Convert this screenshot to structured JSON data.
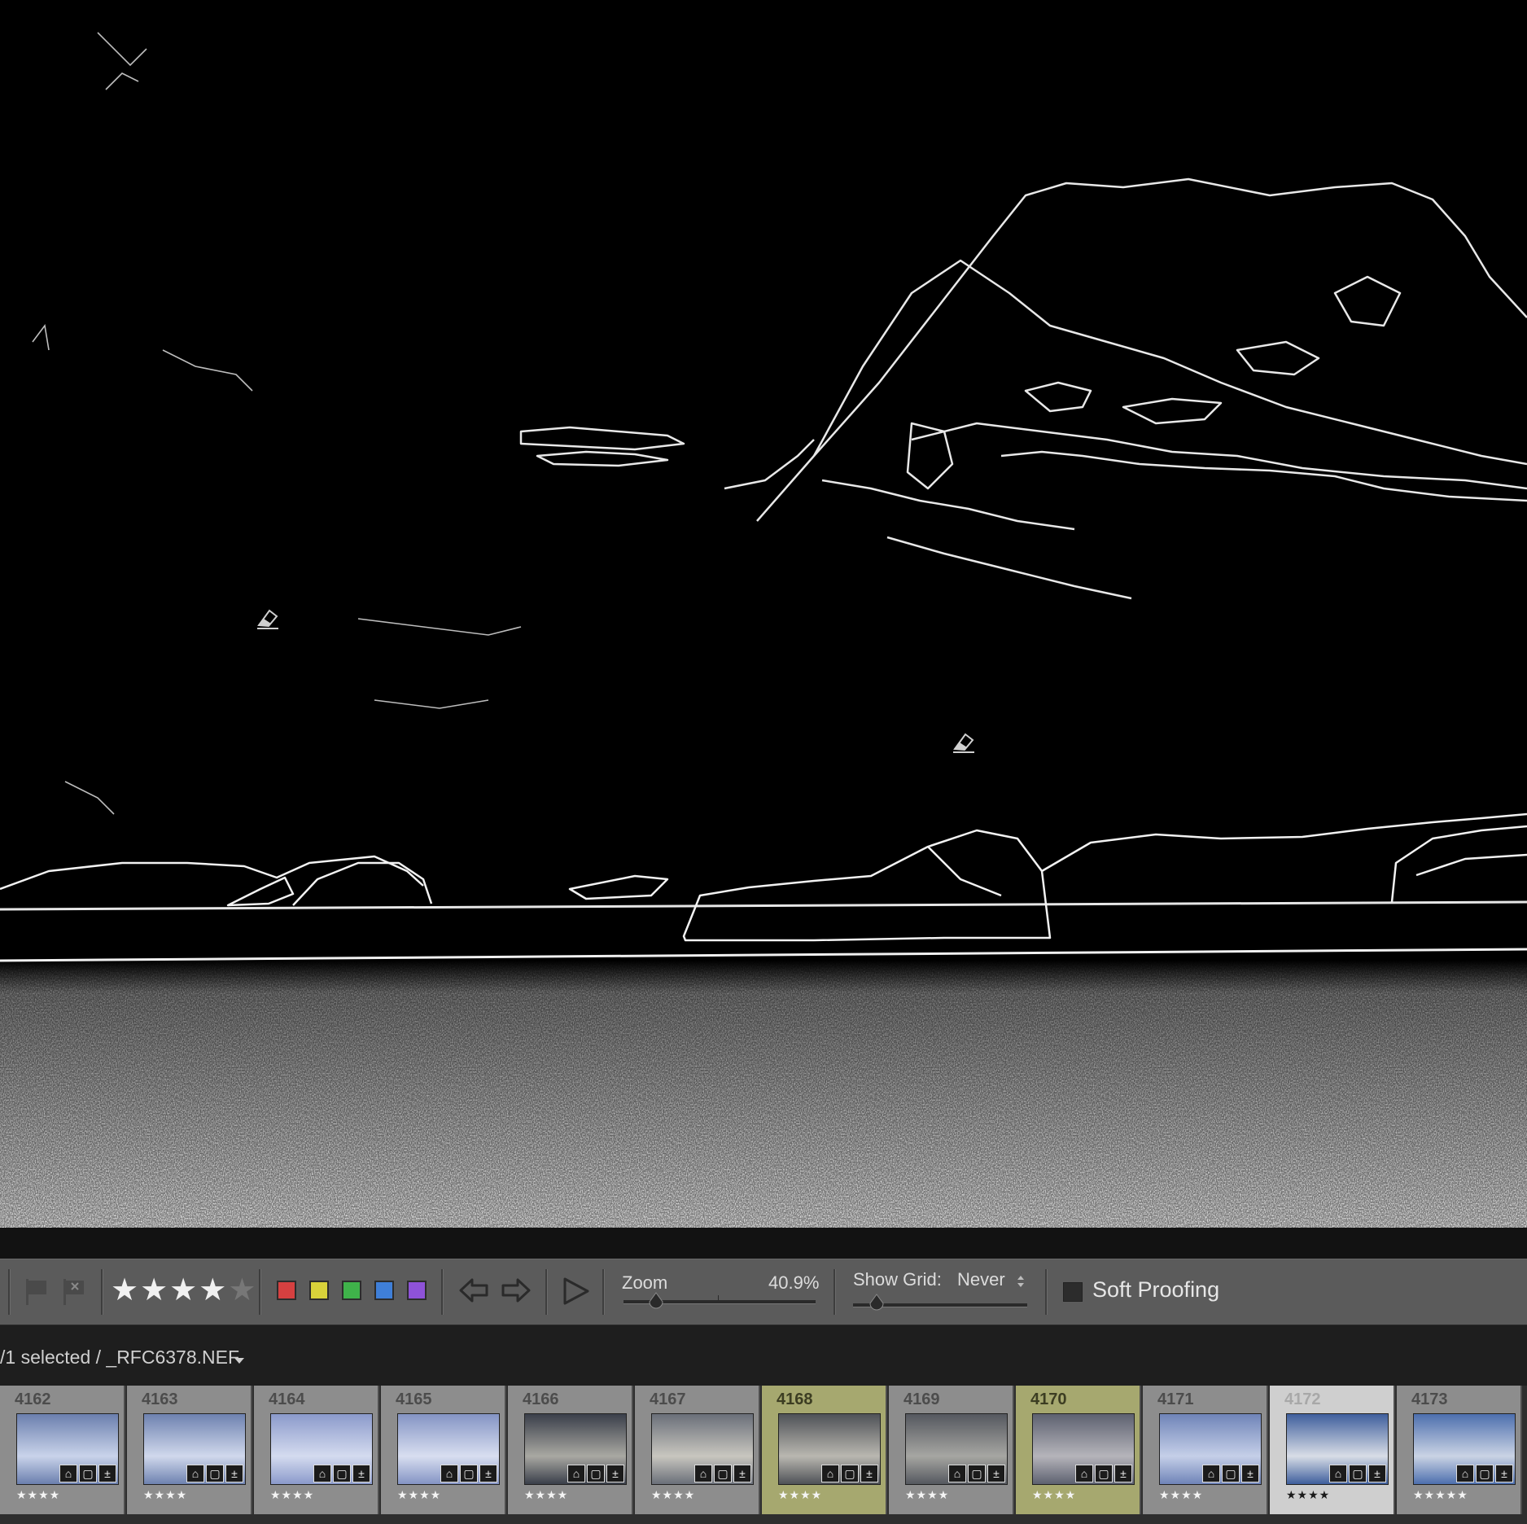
{
  "toolbar": {
    "rating_stars": 4,
    "rating_max": 5,
    "color_labels": [
      "#d64040",
      "#d8d23a",
      "#3fb24a",
      "#3f7fd8",
      "#8e52d8"
    ],
    "zoom_label": "Zoom",
    "zoom_value": "40.9%",
    "zoom_level": 0.409,
    "grid_label": "Show Grid:",
    "grid_value": "Never",
    "soft_proofing_label": "Soft Proofing",
    "soft_proofing_checked": false
  },
  "status": {
    "selection_text": "/1 selected / _RFC6378.NEF"
  },
  "filmstrip": {
    "items": [
      {
        "number": "4162",
        "stars": "★★★★",
        "state": "normal"
      },
      {
        "number": "4163",
        "stars": "★★★★",
        "state": "normal"
      },
      {
        "number": "4164",
        "stars": "★★★★",
        "state": "normal"
      },
      {
        "number": "4165",
        "stars": "★★★★",
        "state": "normal"
      },
      {
        "number": "4166",
        "stars": "★★★★",
        "state": "normal"
      },
      {
        "number": "4167",
        "stars": "★★★★",
        "state": "normal"
      },
      {
        "number": "4168",
        "stars": "★★★★",
        "state": "picked"
      },
      {
        "number": "4169",
        "stars": "★★★★",
        "state": "normal"
      },
      {
        "number": "4170",
        "stars": "★★★★",
        "state": "picked"
      },
      {
        "number": "4171",
        "stars": "★★★★",
        "state": "normal"
      },
      {
        "number": "4172",
        "stars": "★★★★",
        "state": "active"
      },
      {
        "number": "4173",
        "stars": "★★★★★",
        "state": "normal"
      }
    ]
  },
  "icons": {
    "pin": "eraser-pin-icon",
    "flag": "flag-icon",
    "reject": "reject-flag-icon",
    "prev": "arrow-left-icon",
    "next": "arrow-right-icon",
    "play": "play-icon"
  }
}
